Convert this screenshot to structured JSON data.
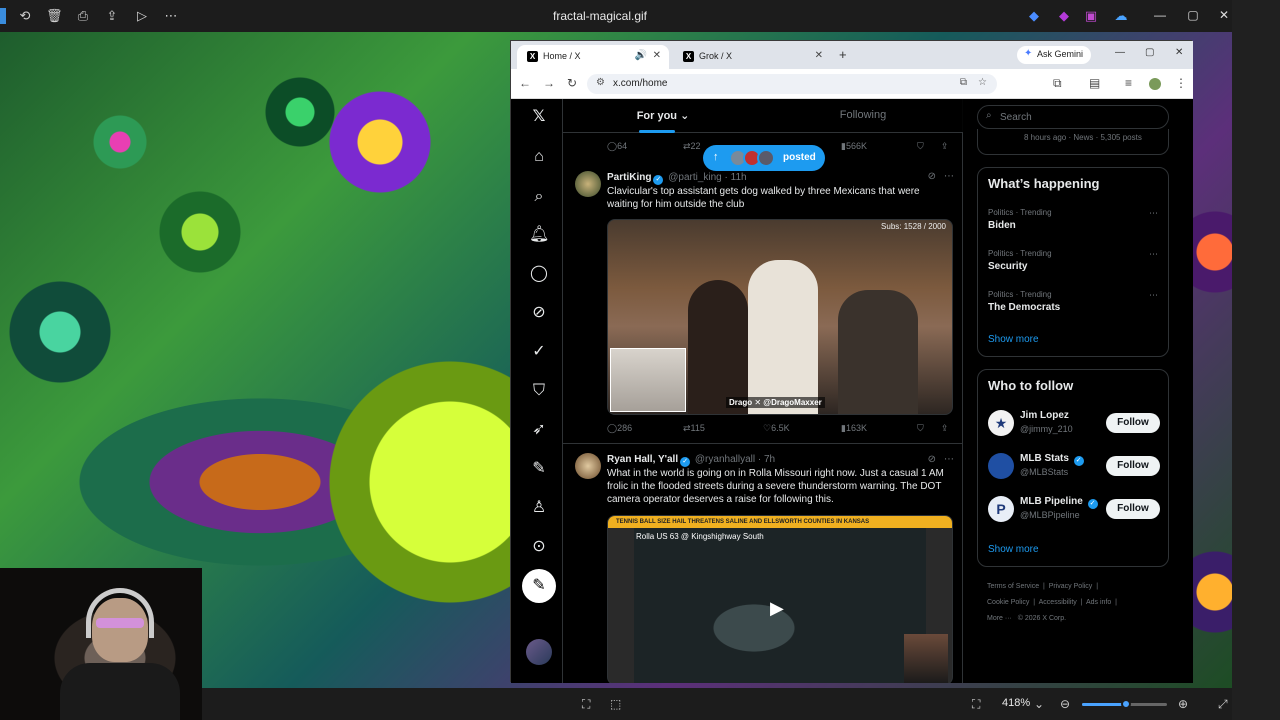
{
  "viewer": {
    "title": "fractal-magical.gif",
    "zoom_label": "418%",
    "zoom_level": 0.52,
    "minimize_glyph": "—",
    "maximize_glyph": "▢",
    "close_glyph": "✕"
  },
  "browser": {
    "tabs": [
      {
        "label": "Home / X",
        "icon": "x-logo"
      },
      {
        "label": "Grok / X",
        "icon": "x-logo"
      }
    ],
    "ask_gemini": "Ask Gemini",
    "url": "x.com/home"
  },
  "feed": {
    "tabs": {
      "for_you": "For you",
      "following": "Following"
    },
    "posted_pill": "posted",
    "top_actions": {
      "replies": "64",
      "reposts": "22",
      "views": "566K"
    },
    "tweets": [
      {
        "name": "PartiKing",
        "handle": "@parti_king",
        "time": "· 11h",
        "text": "Clavicular's top assistant gets dog walked by three Mexicans that were waiting for him outside the club",
        "media_subs": "Subs: 1528 / 2000",
        "media_tag": "Drago ✕ @DragoMaxxer",
        "replies": "286",
        "reposts": "115",
        "likes": "6.5K",
        "views": "163K"
      },
      {
        "name": "Ryan Hall, Y'all",
        "handle": "@ryanhallyall",
        "time": "· 7h",
        "text": "What in the world is going on in Rolla Missouri right now. Just a casual 1 AM frolic in the flooded streets during a severe thunderstorm warning. The DOT camera operator deserves a raise for following this.",
        "media_banner": "TENNIS BALL SIZE HAIL THREATENS SALINE AND ELLSWORTH COUNTIES IN KANSAS",
        "media_cam_label": "Rolla US 63 @ Kingshighway South"
      }
    ]
  },
  "sidebar": {
    "search_placeholder": "Search",
    "partial_card_text": "8 hours ago · News · 5,305 posts",
    "happening": {
      "title": "What’s happening",
      "trends": [
        {
          "meta": "Politics · Trending",
          "name": "Biden"
        },
        {
          "meta": "Politics · Trending",
          "name": "Security"
        },
        {
          "meta": "Politics · Trending",
          "name": "The Democrats"
        }
      ],
      "show_more": "Show more"
    },
    "who_to_follow": {
      "title": "Who to follow",
      "accounts": [
        {
          "name": "Jim Lopez",
          "handle": "@jimmy_210",
          "button": "Follow"
        },
        {
          "name": "MLB Stats",
          "handle": "@MLBStats",
          "button": "Follow"
        },
        {
          "name": "MLB Pipeline",
          "handle": "@MLBPipeline",
          "button": "Follow"
        }
      ],
      "show_more": "Show more"
    },
    "footer": {
      "l1": "Terms of Service",
      "l2": "Privacy Policy",
      "l3": "Cookie Policy",
      "l4": "Accessibility",
      "l5": "Ads info",
      "l6": "More ···",
      "copyright": "© 2026 X Corp."
    }
  },
  "colors": {
    "x_blue": "#1d9bf0",
    "bg_black": "#000000"
  }
}
